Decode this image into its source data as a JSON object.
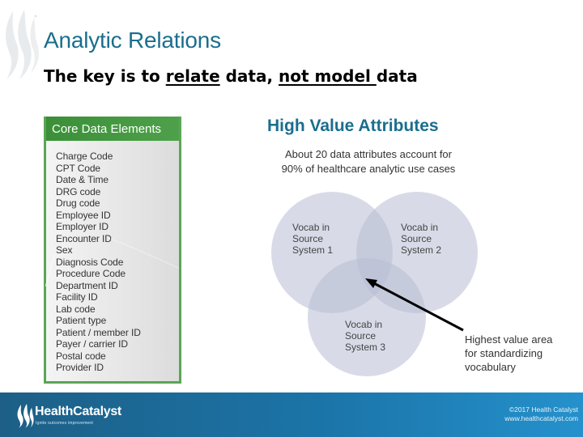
{
  "slide": {
    "title": "Analytic Relations",
    "subtitle": {
      "part1": "The key is to ",
      "part2_underlined": "relate",
      "part3": " data, ",
      "part4_underlined": "not model ",
      "part5": "data"
    }
  },
  "core_data_elements": {
    "heading": "Core Data Elements",
    "items": [
      "Charge Code",
      "CPT Code",
      "Date & Time",
      "DRG code",
      "Drug code",
      "Employee ID",
      "Employer ID",
      "Encounter ID",
      "Sex",
      "Diagnosis Code",
      "Procedure Code",
      "Department ID",
      "Facility ID",
      "Lab code",
      "Patient type",
      "Patient / member ID",
      "Payer / carrier ID",
      "Postal code",
      "Provider ID"
    ],
    "accent_color": "#3f9a3c"
  },
  "high_value_attributes": {
    "heading": "High Value Attributes",
    "description_line1": "About 20 data attributes account for",
    "description_line2": "90% of healthcare analytic use cases",
    "venn": {
      "circles": [
        {
          "label_line1": "Vocab in",
          "label_line2": "Source",
          "label_line3": "System 1"
        },
        {
          "label_line1": "Vocab in",
          "label_line2": "Source",
          "label_line3": "System 2"
        },
        {
          "label_line1": "Vocab in",
          "label_line2": "Source",
          "label_line3": "System 3"
        }
      ],
      "circle_color": "#b8bdd3"
    },
    "callout": {
      "line1": "Highest value area",
      "line2": "for standardizing",
      "line3": "vocabulary"
    }
  },
  "footer": {
    "brand": "HealthCatalyst",
    "tagline": "Ignite outcomes improvement",
    "copyright": "©2017 Health Catalyst",
    "website": "www.healthcatalyst.com"
  }
}
